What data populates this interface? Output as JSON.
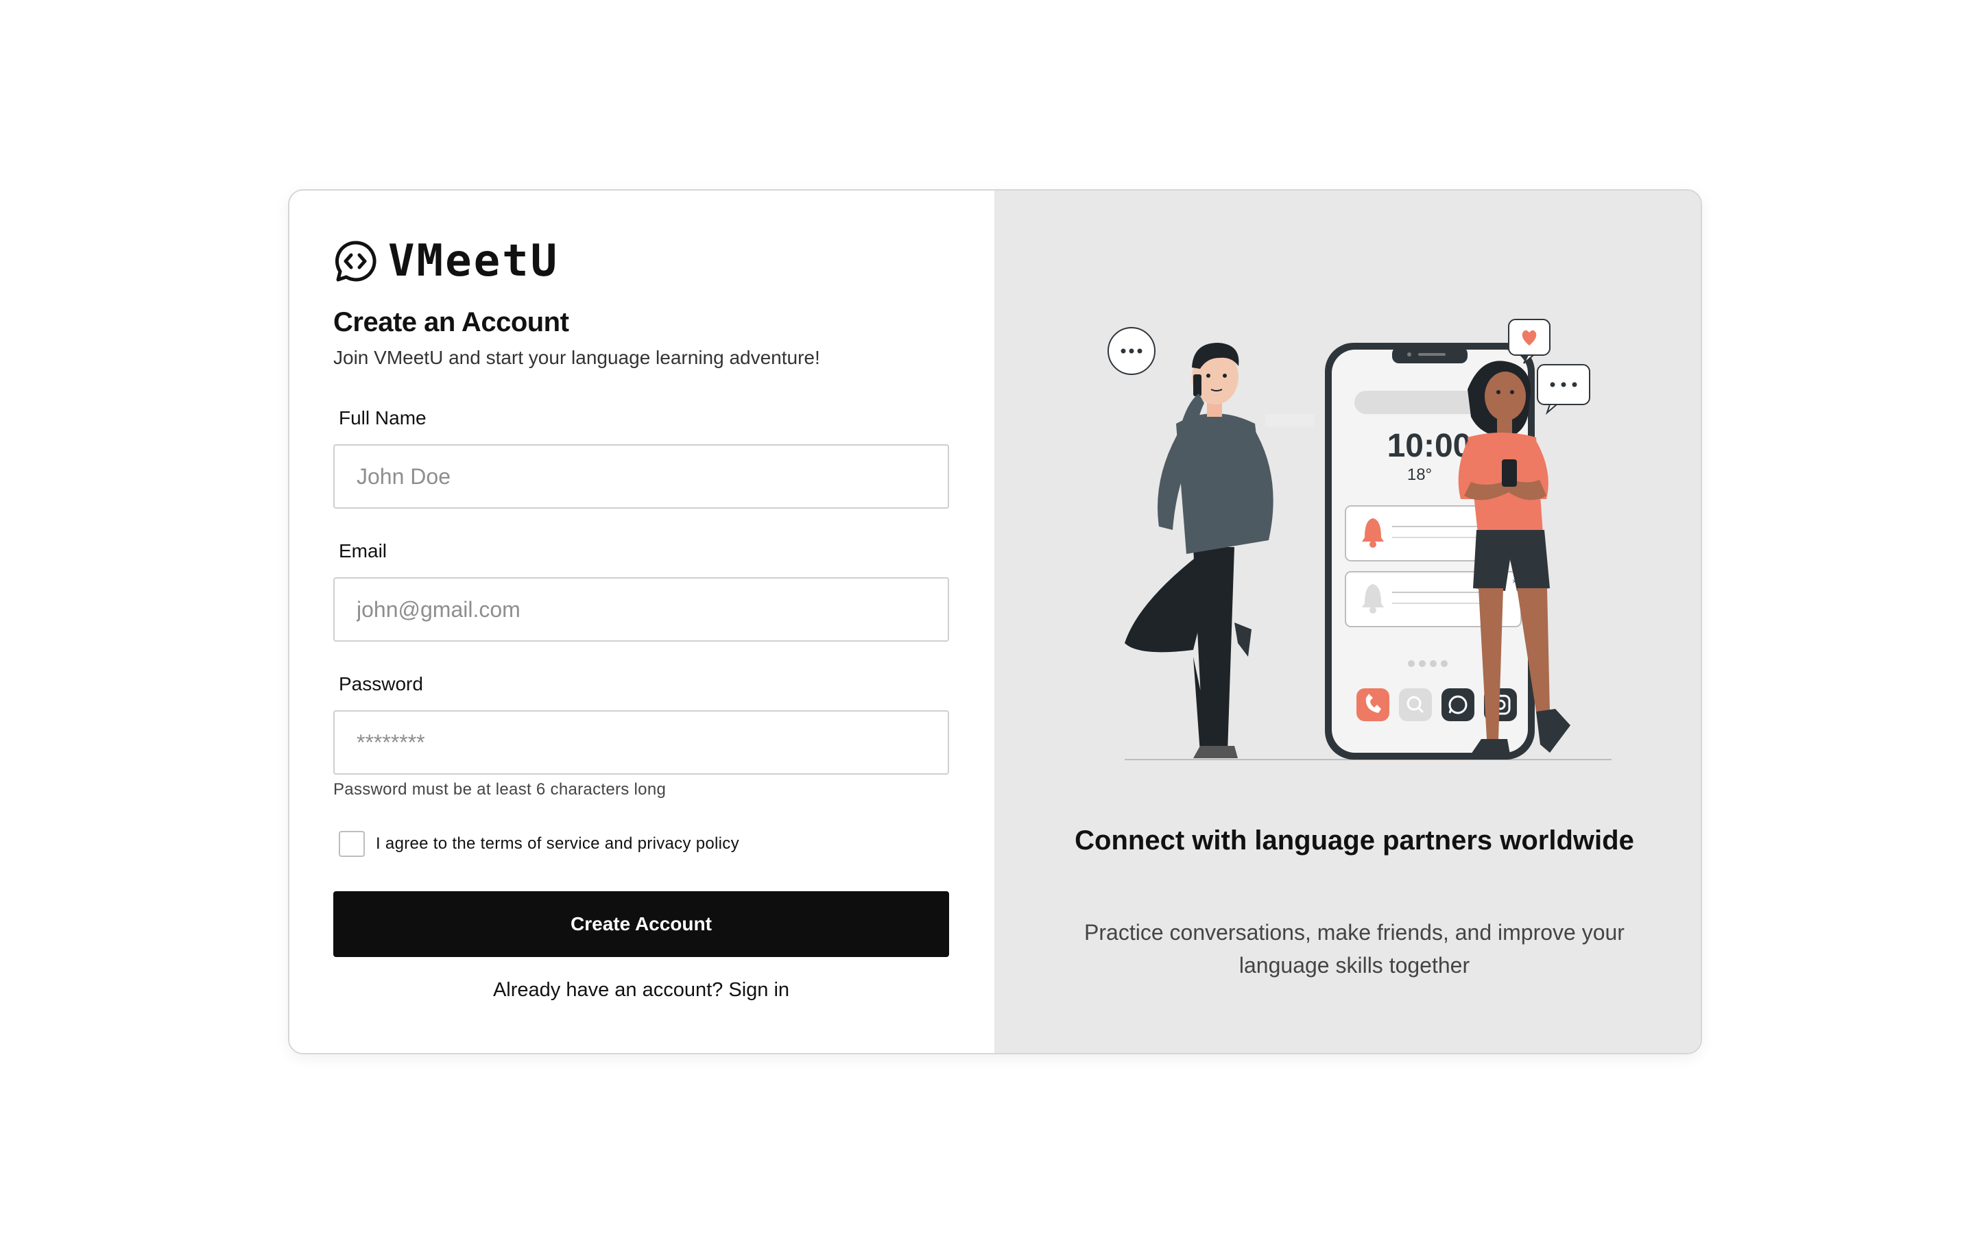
{
  "brand": {
    "name": "VMeetU"
  },
  "form": {
    "title": "Create an Account",
    "subtitle": "Join VMeetU and start your language learning adventure!",
    "full_name": {
      "label": "Full Name",
      "placeholder": "John Doe",
      "value": ""
    },
    "email": {
      "label": "Email",
      "placeholder": "john@gmail.com",
      "value": ""
    },
    "password": {
      "label": "Password",
      "placeholder": "********",
      "value": "",
      "hint": "Password must be at least 6 characters long"
    },
    "terms": {
      "label": "I agree to the terms of service and privacy policy",
      "checked": false
    },
    "submit_label": "Create Account",
    "signin_text": "Already have an account? Sign in"
  },
  "promo": {
    "title": "Connect with language partners worldwide",
    "text": "Practice conversations, make friends, and improve your language skills together",
    "phone_time": "10:00",
    "phone_temp": "18°"
  },
  "colors": {
    "accent": "#ee7a63",
    "button_bg": "#0e0e0e",
    "panel_bg": "#e8e8e8",
    "dark_figure": "#2f363b"
  },
  "icons": {
    "logo": "chat-bubble-code-icon",
    "phone_apps": [
      "phone-icon",
      "search-icon",
      "whatsapp-icon",
      "instagram-icon"
    ]
  }
}
